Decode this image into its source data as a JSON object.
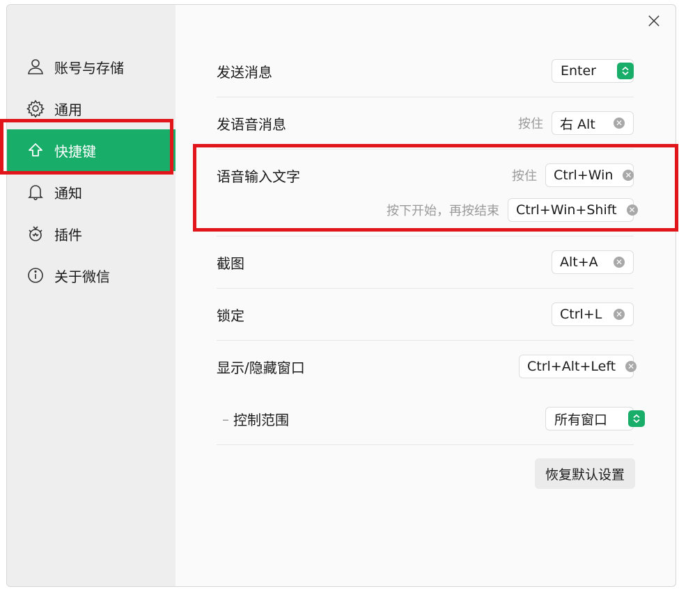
{
  "sidebar": {
    "items": [
      {
        "label": "账号与存储",
        "icon": "user-icon"
      },
      {
        "label": "通用",
        "icon": "gear-icon"
      },
      {
        "label": "快捷键",
        "icon": "arrow-up-icon",
        "active": true
      },
      {
        "label": "通知",
        "icon": "bell-icon"
      },
      {
        "label": "插件",
        "icon": "plugin-icon"
      },
      {
        "label": "关于微信",
        "icon": "info-icon"
      }
    ]
  },
  "shortcuts": {
    "send_message": {
      "label": "发送消息",
      "value": "Enter"
    },
    "voice_message": {
      "label": "发语音消息",
      "hint": "按住",
      "value": "右 Alt"
    },
    "voice_to_text": {
      "label": "语音输入文字",
      "hold_hint": "按住",
      "hold_value": "Ctrl+Win",
      "toggle_hint": "按下开始，再按结束",
      "toggle_value": "Ctrl+Win+Shift"
    },
    "screenshot": {
      "label": "截图",
      "value": "Alt+A"
    },
    "lock": {
      "label": "锁定",
      "value": "Ctrl+L"
    },
    "toggle_window": {
      "label": "显示/隐藏窗口",
      "value": "Ctrl+Alt+Left"
    },
    "control_scope": {
      "label": "控制范围",
      "value": "所有窗口"
    }
  },
  "reset_label": "恢复默认设置",
  "colors": {
    "accent": "#19ad6a",
    "highlight": "#e0161b"
  }
}
